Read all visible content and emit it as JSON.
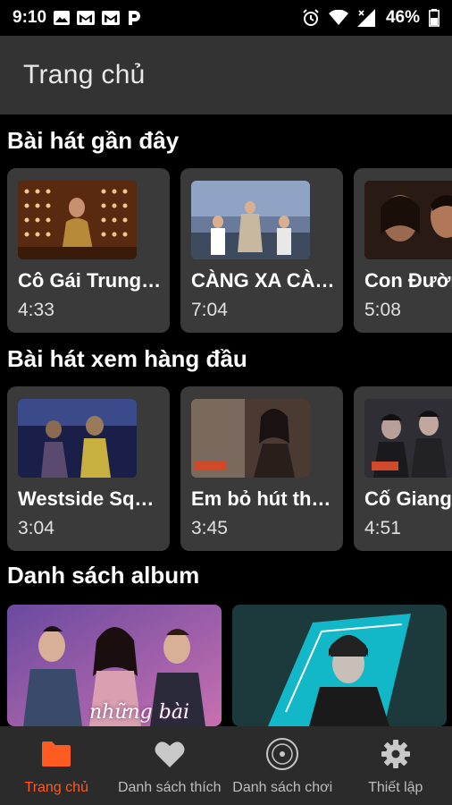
{
  "status_bar": {
    "time": "9:10",
    "battery": "46%",
    "notification_icons": [
      "image-icon",
      "gmail-icon",
      "gmail-icon",
      "p-icon"
    ],
    "system_icons": [
      "alarm-icon",
      "wifi-icon",
      "signal-icon",
      "battery-icon"
    ]
  },
  "app_bar": {
    "title": "Trang chủ"
  },
  "sections": {
    "recent": {
      "title": "Bài hát gần đây",
      "items": [
        {
          "title": "Cô Gái Trung Hoa",
          "duration": "4:33"
        },
        {
          "title": "CÀNG XA CÀNG NHỚ",
          "duration": "7:04"
        },
        {
          "title": "Con Đường",
          "duration": "5:08"
        }
      ]
    },
    "top": {
      "title": "Bài hát xem hàng đầu",
      "items": [
        {
          "title": "Westside Squad",
          "duration": "3:04"
        },
        {
          "title": "Em bỏ hút thuốc",
          "duration": "3:45"
        },
        {
          "title": "Cố Giang Tình",
          "duration": "4:51"
        }
      ]
    },
    "albums": {
      "title": "Danh sách album",
      "items": [
        {
          "cover_text": "những bài"
        },
        {
          "cover_text": ""
        }
      ]
    }
  },
  "bottom_nav": {
    "items": [
      {
        "label": "Trang chủ",
        "icon": "folder-icon",
        "active": true
      },
      {
        "label": "Danh sách thích",
        "icon": "heart-icon",
        "active": false
      },
      {
        "label": "Danh sách chơi",
        "icon": "disc-icon",
        "active": false
      },
      {
        "label": "Thiết lập",
        "icon": "gear-icon",
        "active": false
      }
    ]
  },
  "colors": {
    "accent": "#ff5a1f",
    "app_bar": "#333333",
    "card": "#3a3a3a",
    "nav_bg": "#2b2b2b",
    "background": "#000000"
  }
}
